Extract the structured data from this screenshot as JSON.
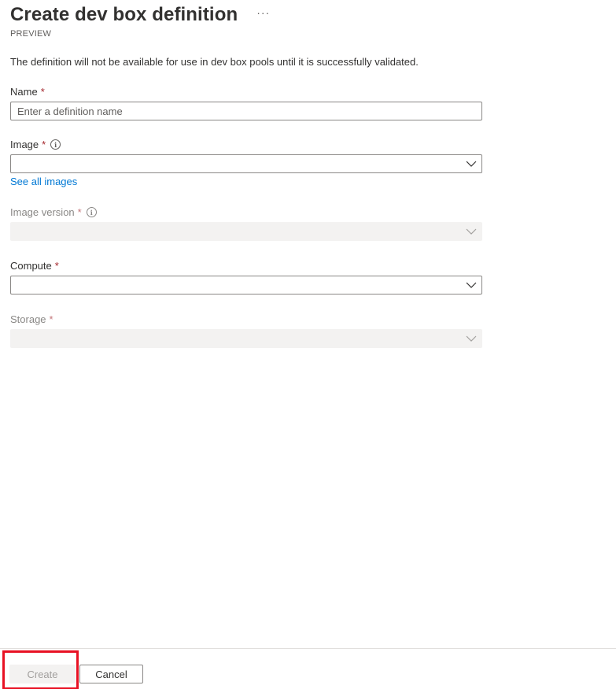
{
  "header": {
    "title": "Create dev box definition",
    "more_icon": "···",
    "subtitle": "PREVIEW"
  },
  "description": "The definition will not be available for use in dev box pools until it is successfully validated.",
  "form": {
    "name": {
      "label": "Name",
      "required_mark": "*",
      "value": "",
      "placeholder": "Enter a definition name"
    },
    "image": {
      "label": "Image",
      "required_mark": "*",
      "info_icon": "i",
      "value": "",
      "link": "See all images"
    },
    "image_version": {
      "label": "Image version",
      "required_mark": "*",
      "info_icon": "i",
      "value": "",
      "disabled": true
    },
    "compute": {
      "label": "Compute",
      "required_mark": "*",
      "value": ""
    },
    "storage": {
      "label": "Storage",
      "required_mark": "*",
      "value": "",
      "disabled": true
    }
  },
  "footer": {
    "create_label": "Create",
    "cancel_label": "Cancel",
    "highlight_color": "#e81123"
  },
  "colors": {
    "link": "#0078d4",
    "required": "#a4262c",
    "disabled_bg": "#f3f2f1"
  }
}
